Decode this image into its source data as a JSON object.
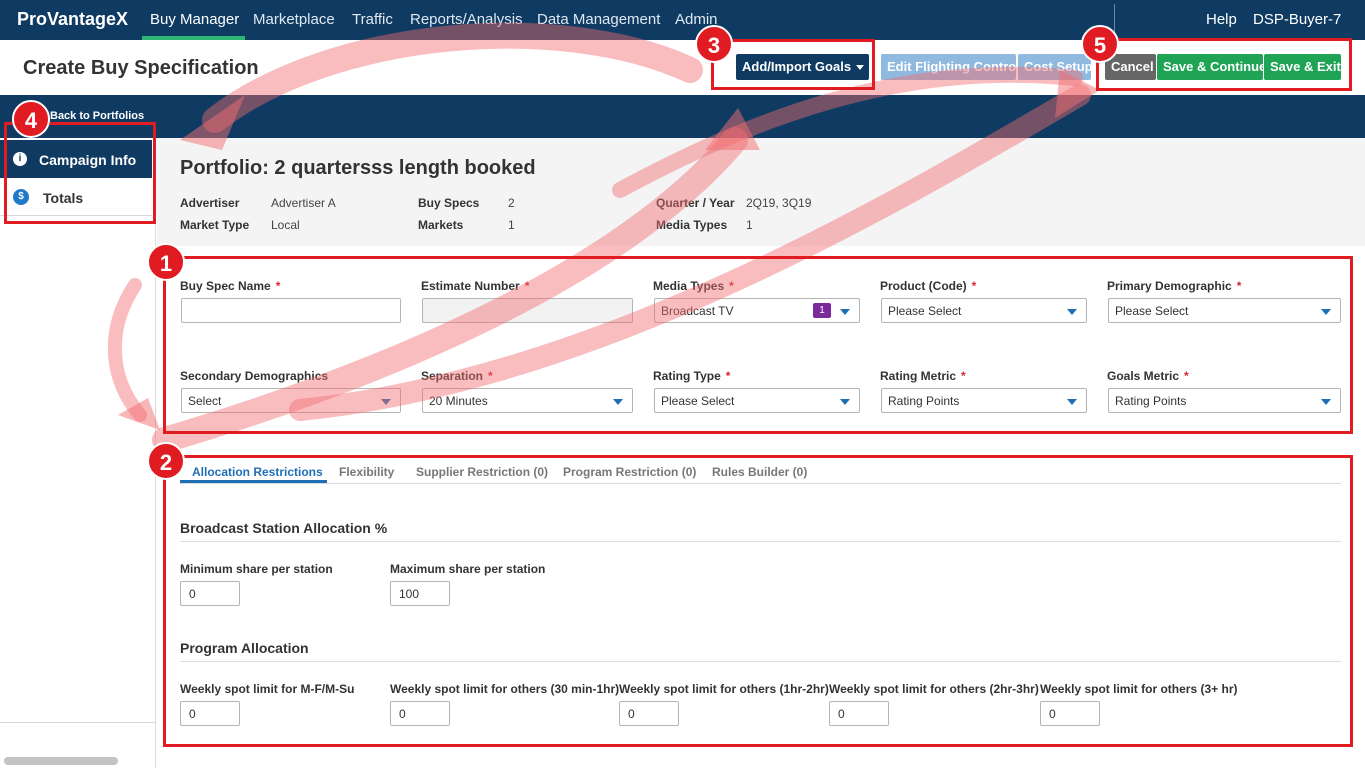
{
  "nav": {
    "brand": "ProVantageX",
    "items": [
      "Buy Manager",
      "Marketplace",
      "Traffic",
      "Reports/Analysis",
      "Data Management",
      "Admin"
    ],
    "help": "Help",
    "user": "DSP-Buyer-7"
  },
  "header": {
    "title": "Create Buy Specification",
    "add_import_goals": "Add/Import Goals",
    "edit_flighting": "Edit Flighting Control",
    "cost_setup": "Cost Setup",
    "cancel": "Cancel",
    "save_continue": "Save & Continue",
    "save_exit": "Save & Exit"
  },
  "back_link": "Back to Portfolios",
  "sidebar": {
    "items": [
      {
        "label": "Campaign Info",
        "icon": "info-icon",
        "glyph": "i"
      },
      {
        "label": "Totals",
        "icon": "dollar-icon",
        "glyph": "$"
      }
    ]
  },
  "portfolio": {
    "title": "Portfolio: 2 quartersss length booked",
    "meta": [
      {
        "label": "Advertiser",
        "value": "Advertiser A"
      },
      {
        "label": "Market Type",
        "value": "Local"
      },
      {
        "label": "Buy Specs",
        "value": "2"
      },
      {
        "label": "Markets",
        "value": "1"
      },
      {
        "label": "Quarter / Year",
        "value": "2Q19, 3Q19"
      },
      {
        "label": "Media Types",
        "value": "1"
      }
    ]
  },
  "form": {
    "buy_spec_name": {
      "label": "Buy Spec Name",
      "value": ""
    },
    "estimate_number": {
      "label": "Estimate Number",
      "value": ""
    },
    "media_types": {
      "label": "Media Types",
      "value": "Broadcast TV",
      "count": "1"
    },
    "product_code": {
      "label": "Product (Code)",
      "value": "Please Select"
    },
    "primary_demo": {
      "label": "Primary Demographic",
      "value": "Please Select"
    },
    "secondary_demo": {
      "label": "Secondary Demographics",
      "value": "Select"
    },
    "separation": {
      "label": "Separation",
      "value": "20 Minutes"
    },
    "rating_type": {
      "label": "Rating Type",
      "value": "Please Select"
    },
    "rating_metric": {
      "label": "Rating Metric",
      "value": "Rating Points"
    },
    "goals_metric": {
      "label": "Goals Metric",
      "value": "Rating Points"
    },
    "required_mark": "*"
  },
  "tabs": [
    "Allocation Restrictions",
    "Flexibility",
    "Supplier Restriction (0)",
    "Program Restriction (0)",
    "Rules Builder (0)"
  ],
  "broadcast": {
    "title": "Broadcast Station Allocation %",
    "min_label": "Minimum share per station",
    "min_value": "0",
    "max_label": "Maximum share per station",
    "max_value": "100"
  },
  "program": {
    "title": "Program Allocation",
    "limits": [
      {
        "label": "Weekly spot limit for M-F/M-Su",
        "value": "0"
      },
      {
        "label": "Weekly spot limit for others (30 min-1hr)",
        "value": "0"
      },
      {
        "label": "Weekly spot limit for others (1hr-2hr)",
        "value": "0"
      },
      {
        "label": "Weekly spot limit for others (2hr-3hr)",
        "value": "0"
      },
      {
        "label": "Weekly spot limit for others (3+ hr)",
        "value": "0"
      }
    ]
  },
  "annotations": [
    "1",
    "2",
    "3",
    "4",
    "5"
  ],
  "colors": {
    "nav_bg": "#0f3b62",
    "active_green": "#2bb673",
    "save_green": "#1fa355",
    "annotation_red": "#e01b22",
    "link_blue": "#1f6fb5"
  }
}
